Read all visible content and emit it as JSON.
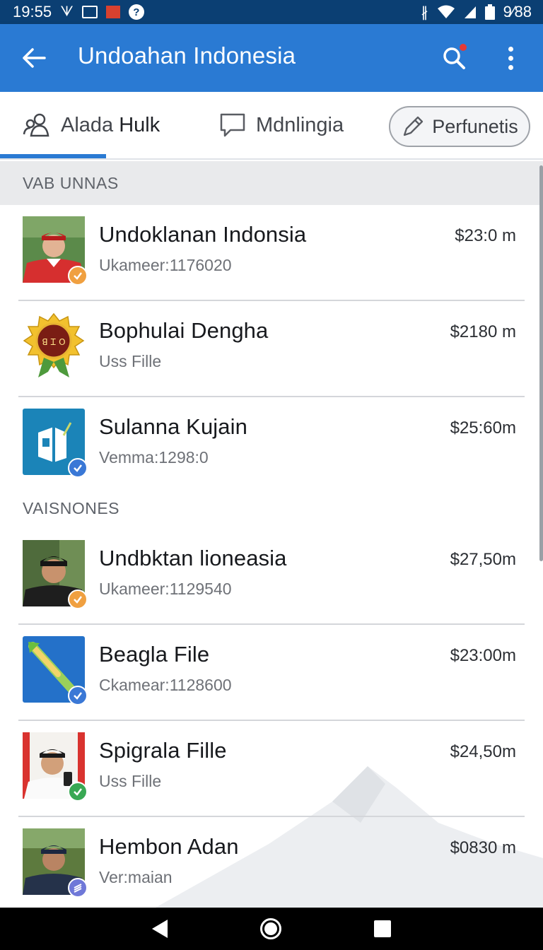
{
  "status_bar": {
    "time": "19:55",
    "clock_right": "9⁄88",
    "icons": [
      "signal-bars-icon",
      "screenshot-icon",
      "app-red-icon",
      "help-icon",
      "bluetooth-icon",
      "wifi-icon",
      "cell-signal-icon",
      "battery-icon"
    ]
  },
  "app_bar": {
    "title": "Undoahan Indonesia",
    "back_icon": "arrow-left-icon",
    "search_icon": "search-icon",
    "more_icon": "more-vert-icon",
    "accent": "#2a7ad3"
  },
  "tabs": [
    {
      "label_a": "Alada",
      "label_b": "Hulk",
      "icon": "group-icon",
      "selected": true
    },
    {
      "label": "Mdnlingia",
      "icon": "chat-bubble-icon",
      "selected": false
    },
    {
      "label": "Perfunetis",
      "icon": "pencil-icon",
      "style": "pill"
    }
  ],
  "sections": [
    {
      "header": "VAB UNNAS"
    },
    {
      "header": "VAISNONES"
    }
  ],
  "items": [
    {
      "title": "Undoklanan Indonsia",
      "subtitle": "Ukameer:1176020",
      "price": "$23:0",
      "unit": "m",
      "badge": "orange-check"
    },
    {
      "title": "Bophulai Dengha",
      "subtitle": "Uss Fille",
      "price": "$2180",
      "unit": "m",
      "emblem_text": "ꓭ Ꮖ O",
      "badge": "none"
    },
    {
      "title": "Sulanna Kujain",
      "subtitle": "Vemma:1298:0",
      "price": "$25:60",
      "unit": "m",
      "badge": "blue-check"
    },
    {
      "title": "Undbktan lioneasia",
      "subtitle": "Ukameer:1129540",
      "price": "$27,50",
      "unit": "m",
      "badge": "orange-check"
    },
    {
      "title": "Beagla File",
      "subtitle": "Ckamear:1128600",
      "price": "$23:00",
      "unit": "m",
      "badge": "blue-check"
    },
    {
      "title": "Spigrala Fille",
      "subtitle": "Uss Fille",
      "price": "$24,50",
      "unit": "m",
      "badge": "green-check"
    },
    {
      "title": "Hembon Adan",
      "subtitle": "Ver:maian",
      "price": "$0830",
      "unit": "m",
      "badge": "indigo-stack"
    }
  ],
  "nav_bar": {
    "icons": [
      "nav-back-icon",
      "nav-home-icon",
      "nav-recents-icon"
    ]
  }
}
